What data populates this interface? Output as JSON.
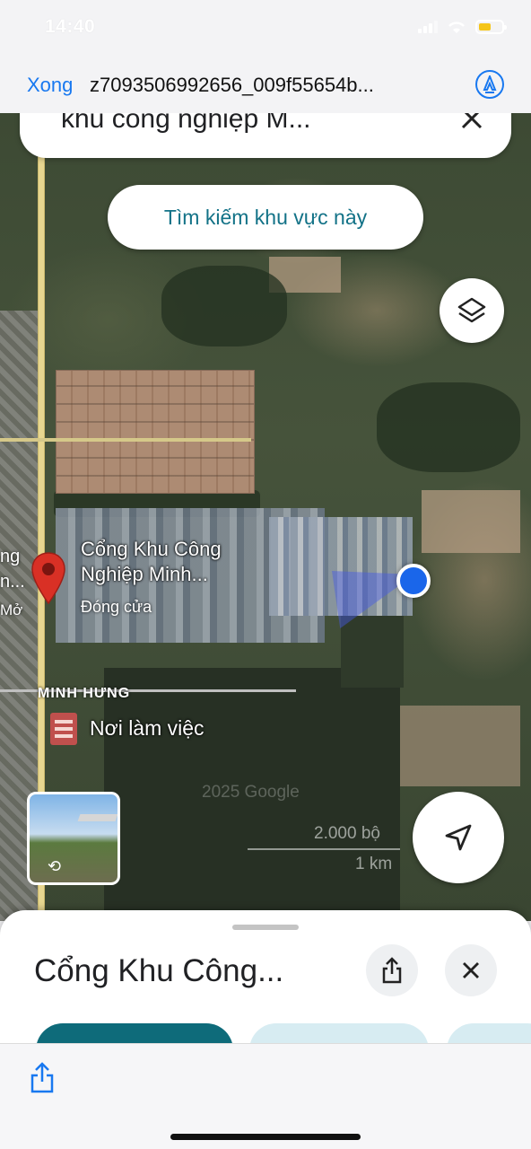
{
  "status_bar": {
    "time": "14:40"
  },
  "viewer": {
    "done_label": "Xong",
    "filename": "z7093506992656_009f55654b..."
  },
  "map": {
    "search_text": "khu công nghiệp M...",
    "search_area_button": "Tìm kiếm khu vực này",
    "place_name_line1": "Cổng Khu Công",
    "place_name_line2": "Nghiệp Minh...",
    "place_status": "Đóng cửa",
    "clipped_label_line1": "ng",
    "clipped_label_line2": "n...",
    "clipped_label_status": "Mở",
    "area_label": "MINH HƯNG",
    "work_label": "Nơi làm việc",
    "watermark": "2025 Google",
    "scale_feet": "2.000 bộ",
    "scale_km": "1 km",
    "accent_color": "#1a66ea"
  },
  "sheet": {
    "title": "Cổng Khu Công..."
  },
  "icons": [
    "markup-icon",
    "close-icon",
    "layers-icon",
    "navigation-arrow-icon",
    "map-pin-icon",
    "share-icon",
    "building-icon",
    "street-view-rotate-icon"
  ]
}
